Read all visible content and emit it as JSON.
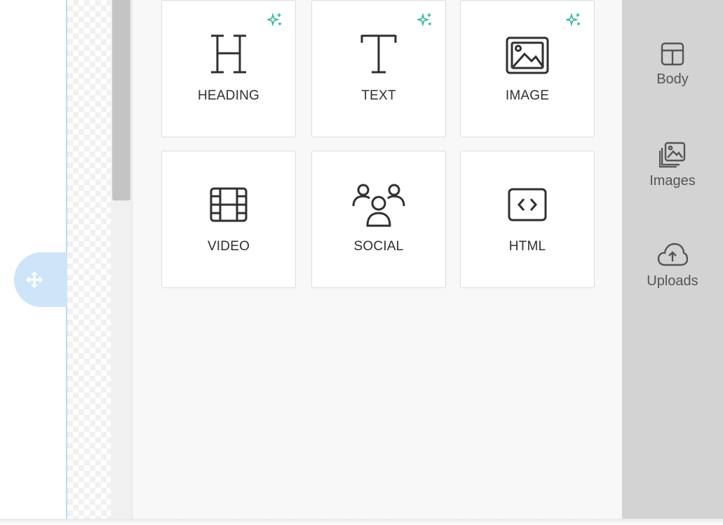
{
  "colors": {
    "accent_sparkle": "#2fb99a",
    "handle_bg": "#cde4f9",
    "sidebar_bg": "#d3d3d3",
    "panel_bg": "#f8f8f8"
  },
  "content_blocks": [
    {
      "label": "HEADING",
      "icon": "heading-icon",
      "ai": true
    },
    {
      "label": "TEXT",
      "icon": "text-icon",
      "ai": true
    },
    {
      "label": "IMAGE",
      "icon": "image-icon",
      "ai": true
    },
    {
      "label": "VIDEO",
      "icon": "video-icon",
      "ai": false
    },
    {
      "label": "SOCIAL",
      "icon": "social-icon",
      "ai": false
    },
    {
      "label": "HTML",
      "icon": "html-code-icon",
      "ai": false
    }
  ],
  "sidebar": {
    "items": [
      {
        "label": "Body",
        "icon": "layout-icon"
      },
      {
        "label": "Images",
        "icon": "images-icon"
      },
      {
        "label": "Uploads",
        "icon": "cloud-upload-icon"
      }
    ]
  },
  "canvas": {
    "handle_icon": "move-icon"
  }
}
